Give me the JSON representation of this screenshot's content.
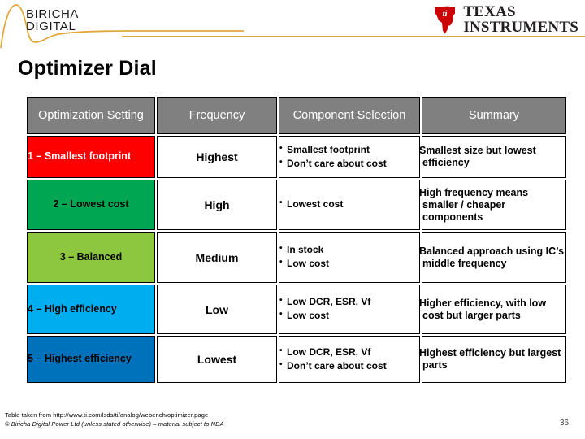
{
  "header": {
    "biricha_logo": {
      "line1": "BIRICHA",
      "line2": "DIGITAL",
      "icon": "damped-oscillation-waveform-icon",
      "accent_color": "#e0a83c"
    },
    "ti_logo": {
      "line1": "TEXAS",
      "line2": "INSTRUMENTS",
      "mark_label": "ti",
      "mark_color": "#cc0000",
      "text_color": "#231f20"
    },
    "rule_color": "#e0a83c"
  },
  "title": "Optimizer Dial",
  "table": {
    "header_bg": "#808080",
    "header_fg": "#ffffff",
    "columns": [
      {
        "label": "Optimization Setting",
        "name": "optimization-setting"
      },
      {
        "label": "Frequency",
        "name": "frequency"
      },
      {
        "label": "Component Selection",
        "name": "component-selection"
      },
      {
        "label": "Summary",
        "name": "summary"
      }
    ],
    "rows": [
      {
        "setting": "1 – Smallest footprint",
        "setting_bg": "#fe0000",
        "setting_fg": "#ffffff",
        "setting_align": "left",
        "frequency": "Highest",
        "components": [
          "Smallest footprint",
          "Don’t care about cost"
        ],
        "summary": "Smallest size but lowest efficiency"
      },
      {
        "setting": "2 – Lowest cost",
        "setting_bg": "#00a651",
        "setting_fg": "#000000",
        "setting_align": "center",
        "frequency": "High",
        "components": [
          "Lowest cost"
        ],
        "summary": "High frequency means smaller / cheaper components"
      },
      {
        "setting": "3 – Balanced",
        "setting_bg": "#8dc63f",
        "setting_fg": "#000000",
        "setting_align": "center",
        "frequency": "Medium",
        "components": [
          "In stock",
          "Low cost"
        ],
        "summary": "Balanced approach using IC’s middle frequency"
      },
      {
        "setting": "4 – High efficiency",
        "setting_bg": "#00aeef",
        "setting_fg": "#000000",
        "setting_align": "left",
        "frequency": "Low",
        "components": [
          "Low DCR, ESR, Vf",
          "Low cost"
        ],
        "summary": "Higher efficiency, with low cost but larger parts"
      },
      {
        "setting": "5 – Highest efficiency",
        "setting_bg": "#0072bc",
        "setting_fg": "#000000",
        "setting_align": "left",
        "frequency": "Lowest",
        "components": [
          "Low DCR, ESR, Vf",
          "Don’t care about cost"
        ],
        "summary": "Highest efficiency but largest parts"
      }
    ]
  },
  "footer": {
    "source_note": "Table taken from http://www.ti.com/lsds/ti/analog/webench/optimizer.page",
    "copyright": "© Biricha Digital Power Ltd  (unless stated otherwise) – material subject to NDA",
    "page_number": "36"
  }
}
